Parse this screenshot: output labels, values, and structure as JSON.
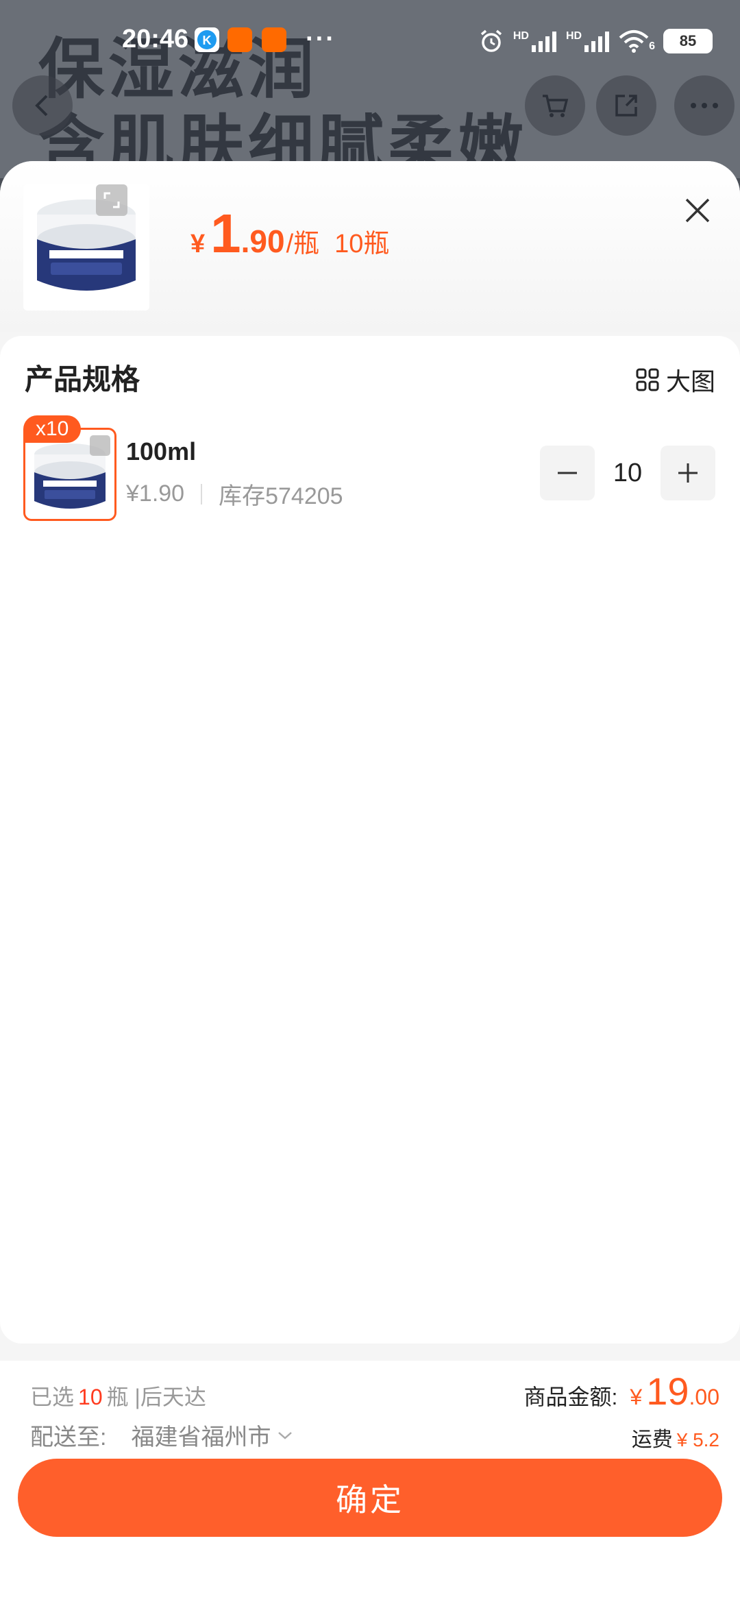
{
  "status_bar": {
    "time": "20:46",
    "network_1": "HD",
    "network_2": "HD",
    "wifi_sub": "6",
    "battery": "85"
  },
  "background_page": {
    "headline_1": "保湿滋润",
    "headline_2": "含肌肤细腻柔嫩"
  },
  "sheet": {
    "price_symbol": "¥",
    "price_int": "1",
    "price_dec": ".90",
    "price_unit": "/瓶",
    "quantity_text": "10瓶",
    "product_label": {
      "brand": "Nicor",
      "line1": "维生素E尿素霜",
      "line2": "特别添加维生素E",
      "line3": "蕴含尿素成分"
    }
  },
  "spec_section": {
    "title": "产品规格",
    "big_image_label": "大图",
    "item": {
      "badge": "x10",
      "name": "100ml",
      "price": "¥1.90",
      "stock": "库存574205",
      "quantity": "10"
    }
  },
  "footer": {
    "selected_prefix": "已选",
    "selected_count": "10",
    "selected_suffix": "瓶 |后天达",
    "ship_label": "配送至:",
    "ship_city": "福建省福州市",
    "total_label": "商品金额:",
    "total_symbol": "¥",
    "total_int": "19",
    "total_dec": ".00",
    "freight_label": "运费",
    "freight_value": "¥ 5.2",
    "confirm_label": "确定"
  },
  "colors": {
    "accent": "#ff5a1f",
    "button": "#ff5f2b"
  }
}
